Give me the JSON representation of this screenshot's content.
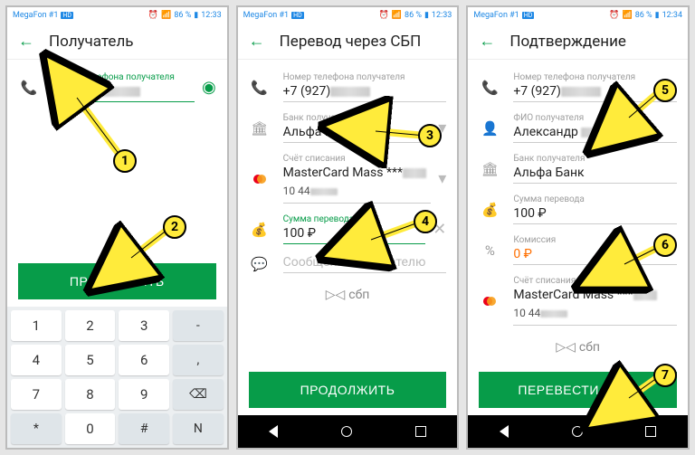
{
  "status": {
    "carrier": "MegaFon #1",
    "hd": "HD",
    "battery": "86 %",
    "time1": "12:33",
    "time2": "12:34"
  },
  "screen1": {
    "title": "Получатель",
    "phone_label": "Номер телефона получателя",
    "phone_value": "+7 (927)",
    "continue": "ПРОДОЛЖИТЬ",
    "keys": [
      "1",
      "2",
      "3",
      "-",
      "4",
      "5",
      "6",
      ",",
      "7",
      "8",
      "9",
      "⌫",
      "*",
      "0",
      "#",
      "N"
    ]
  },
  "screen2": {
    "title": "Перевод через СБП",
    "phone_label": "Номер телефона получателя",
    "phone_value": "+7 (927)",
    "bank_label": "Банк получателя",
    "bank_value": "Альфа Банк",
    "card_label": "Счёт списания",
    "card_name": "MasterCard Mass ***",
    "card_balance": "10 44",
    "amount_label": "Сумма перевода",
    "amount_value": "100 ₽",
    "message_label": "Сообщение получателю",
    "sbp_label": "сбп",
    "continue": "ПРОДОЛЖИТЬ"
  },
  "screen3": {
    "title": "Подтверждение",
    "phone_label": "Номер телефона получателя",
    "phone_value": "+7 (927)",
    "fio_label": "ФИО получателя",
    "fio_value": "Александр",
    "bank_label": "Банк получателя",
    "bank_value": "Альфа Банк",
    "amount_label": "Сумма перевода",
    "amount_value": "100 ₽",
    "fee_label": "Комиссия",
    "fee_value": "0 ₽",
    "card_label": "Счёт списания",
    "card_name": "MasterCard Mass ***",
    "card_balance": "10 44",
    "sbp_label": "сбп",
    "transfer": "ПЕРЕВЕСТИ 100 ₽"
  },
  "callouts": [
    "1",
    "2",
    "3",
    "4",
    "5",
    "6",
    "7"
  ]
}
